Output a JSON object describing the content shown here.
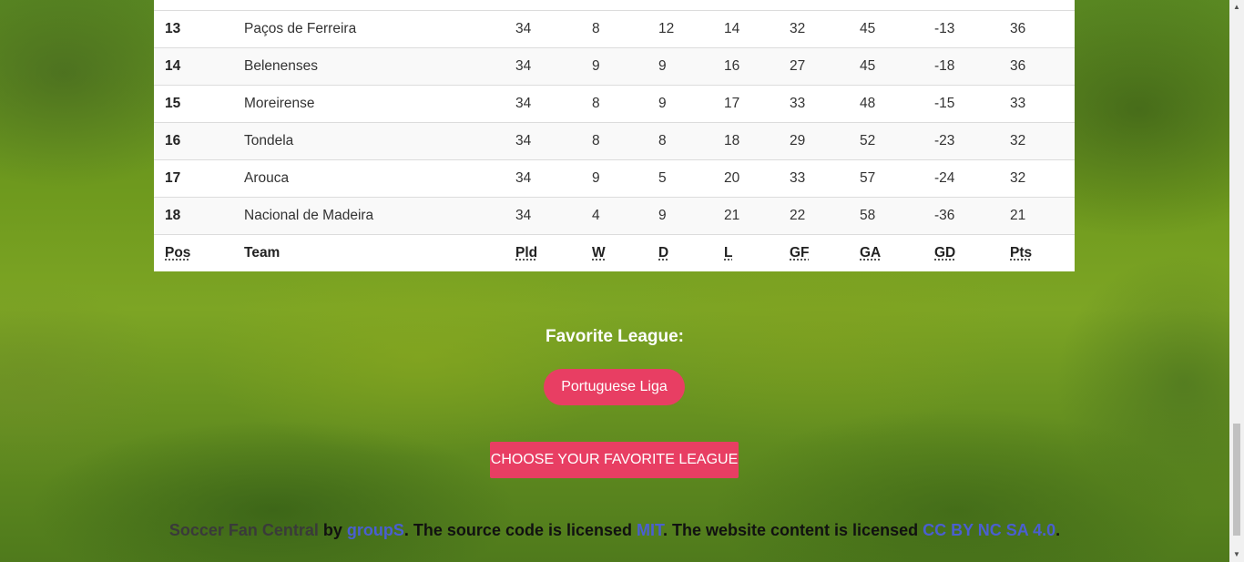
{
  "standings": {
    "rows": [
      {
        "pos": "13",
        "team": "Paços de Ferreira",
        "pld": "34",
        "w": "8",
        "d": "12",
        "l": "14",
        "gf": "32",
        "ga": "45",
        "gd": "-13",
        "pts": "36"
      },
      {
        "pos": "14",
        "team": "Belenenses",
        "pld": "34",
        "w": "9",
        "d": "9",
        "l": "16",
        "gf": "27",
        "ga": "45",
        "gd": "-18",
        "pts": "36"
      },
      {
        "pos": "15",
        "team": "Moreirense",
        "pld": "34",
        "w": "8",
        "d": "9",
        "l": "17",
        "gf": "33",
        "ga": "48",
        "gd": "-15",
        "pts": "33"
      },
      {
        "pos": "16",
        "team": "Tondela",
        "pld": "34",
        "w": "8",
        "d": "8",
        "l": "18",
        "gf": "29",
        "ga": "52",
        "gd": "-23",
        "pts": "32"
      },
      {
        "pos": "17",
        "team": "Arouca",
        "pld": "34",
        "w": "9",
        "d": "5",
        "l": "20",
        "gf": "33",
        "ga": "57",
        "gd": "-24",
        "pts": "32"
      },
      {
        "pos": "18",
        "team": "Nacional de Madeira",
        "pld": "34",
        "w": "4",
        "d": "9",
        "l": "21",
        "gf": "22",
        "ga": "58",
        "gd": "-36",
        "pts": "21"
      }
    ],
    "footer": {
      "pos": "Pos",
      "team": "Team",
      "pld": "Pld",
      "w": "W",
      "d": "D",
      "l": "L",
      "gf": "GF",
      "ga": "GA",
      "gd": "GD",
      "pts": "Pts"
    }
  },
  "favorite": {
    "title": "Favorite League:",
    "league": "Portuguese Liga",
    "choose_button": "CHOOSE YOUR FAVORITE LEAGUE"
  },
  "footer": {
    "site_name": "Soccer Fan Central",
    "by": " by ",
    "author": "groupS",
    "source_text": ". The source code is licensed ",
    "source_license": "MIT",
    "content_text": ". The website content is licensed ",
    "content_license": "CC BY NC SA 4.0",
    "end": "."
  },
  "colors": {
    "accent": "#e83e63",
    "link": "#4a5fd0"
  }
}
